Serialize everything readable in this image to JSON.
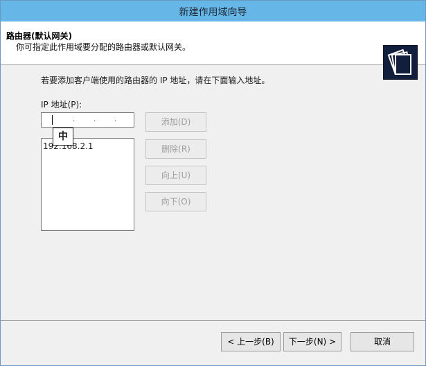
{
  "window": {
    "title": "新建作用域向导"
  },
  "header": {
    "title": "路由器(默认网关)",
    "subtitle": "你可指定此作用域要分配的路由器或默认网关。",
    "icon": "wizard-folder-icon"
  },
  "main": {
    "instruction": "若要添加客户端使用的路由器的 IP 地址，请在下面输入地址。",
    "ip_label": "IP 地址(P):",
    "ip_input_value": "",
    "ime_indicator": "中",
    "router_list": [
      "192.168.2.1"
    ],
    "buttons": {
      "add": "添加(D)",
      "remove": "删除(R)",
      "up": "向上(U)",
      "down": "向下(O)"
    }
  },
  "footer": {
    "back": "< 上一步(B)",
    "next": "下一步(N) >",
    "cancel": "取消"
  }
}
